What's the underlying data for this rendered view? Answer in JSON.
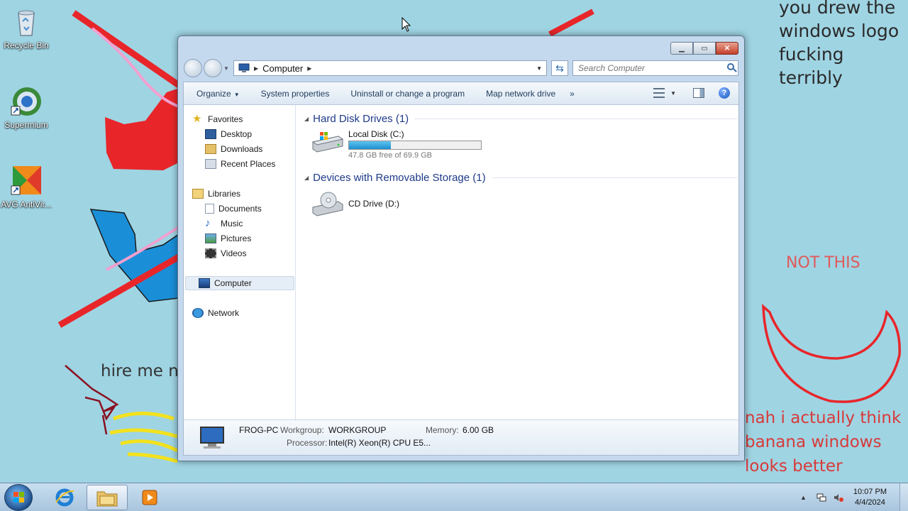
{
  "desktop": {
    "icons": [
      {
        "label": "Recycle Bin"
      },
      {
        "label": "Supermium"
      },
      {
        "label": "AVG AntiVir..."
      }
    ],
    "notes": {
      "top_lines": [
        "you drew the",
        "windows logo",
        "fucking terribly"
      ],
      "hire": "hire me n",
      "not_this": "NOT THIS",
      "nah_lines": [
        "nah i actually think",
        "banana windows",
        "looks better"
      ]
    }
  },
  "window": {
    "address": {
      "location": "Computer"
    },
    "search": {
      "placeholder": "Search Computer"
    },
    "toolbar": {
      "organize": "Organize",
      "system_properties": "System properties",
      "uninstall": "Uninstall or change a program",
      "map_drive": "Map network drive",
      "more": "»"
    },
    "nav": {
      "favorites": "Favorites",
      "desktop": "Desktop",
      "downloads": "Downloads",
      "recent": "Recent Places",
      "libraries": "Libraries",
      "documents": "Documents",
      "music": "Music",
      "pictures": "Pictures",
      "videos": "Videos",
      "computer": "Computer",
      "network": "Network"
    },
    "groups": {
      "hdd": "Hard Disk Drives (1)",
      "removable": "Devices with Removable Storage (1)"
    },
    "drives": {
      "c": {
        "name": "Local Disk (C:)",
        "free_text": "47.8 GB free of 69.9 GB",
        "used_fraction": 0.316
      },
      "d": {
        "name": "CD Drive (D:)"
      }
    },
    "details": {
      "pc_name": "FROG-PC",
      "workgroup_label": "Workgroup:",
      "workgroup": "WORKGROUP",
      "memory_label": "Memory:",
      "memory": "6.00 GB",
      "processor_label": "Processor:",
      "processor": "Intel(R) Xeon(R) CPU E5..."
    }
  },
  "taskbar": {
    "time": "10:07 PM",
    "date": "4/4/2024"
  },
  "colors": {
    "desktop_bg": "#9fd4e3",
    "group_title": "#1e3a8a",
    "usage_bar": "#1c8fd0"
  }
}
